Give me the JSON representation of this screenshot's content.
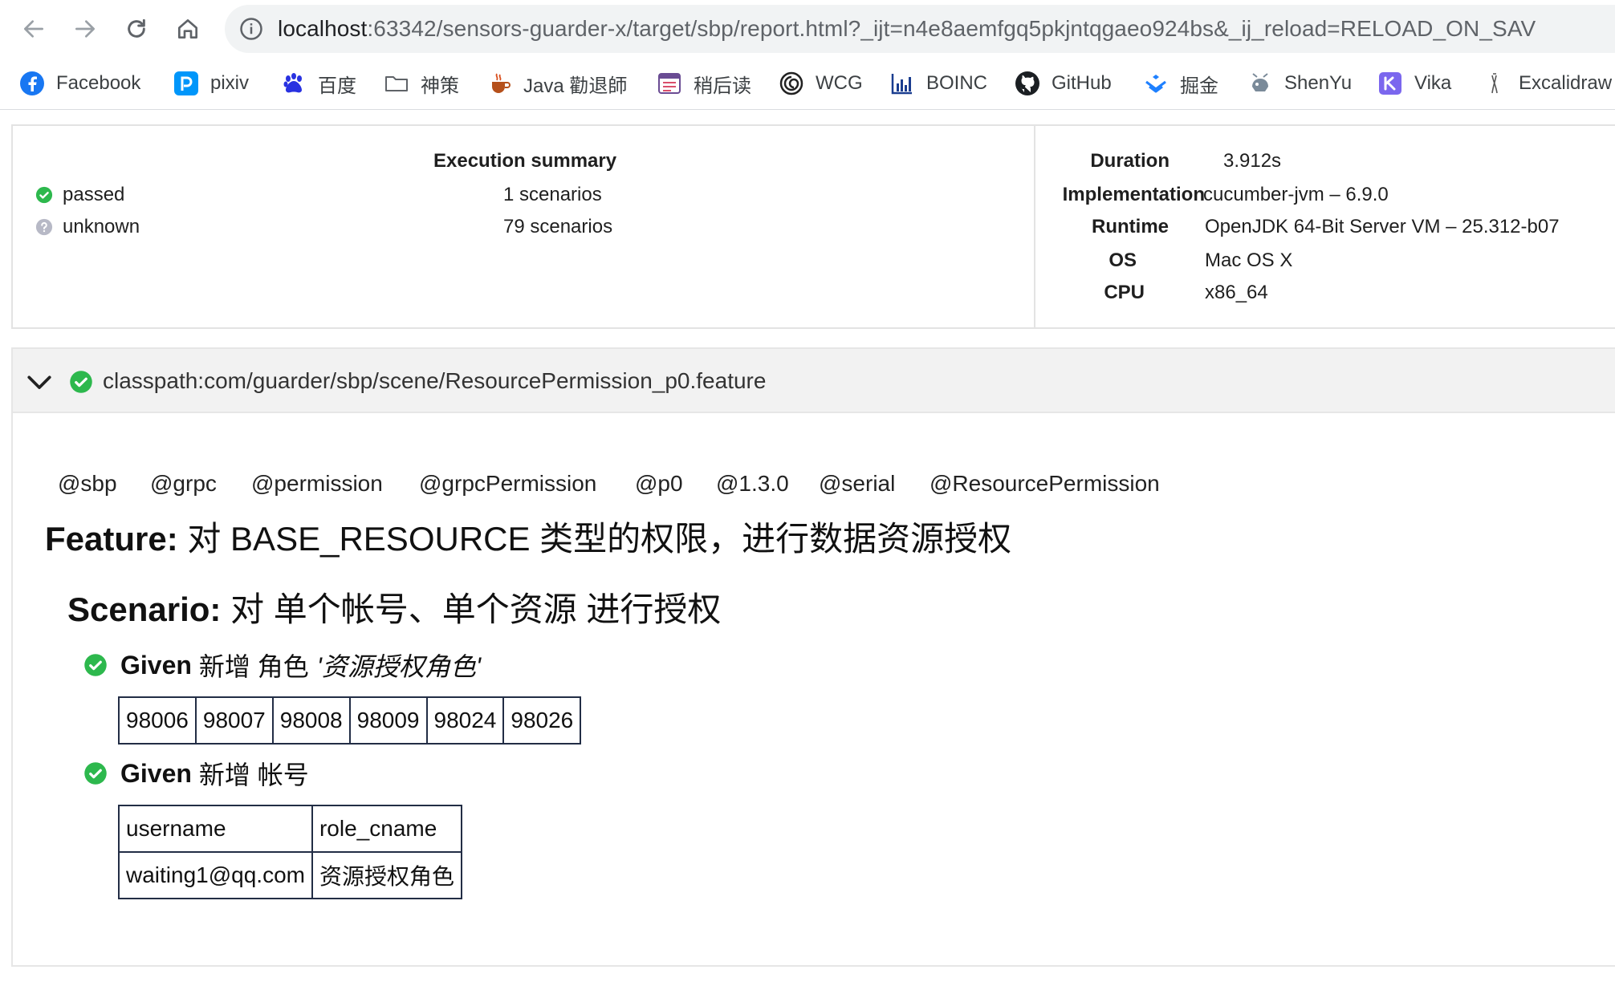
{
  "browser": {
    "url_host": "localhost",
    "url_rest": ":63342/sensors-guarder-x/target/sbp/report.html?_ijt=n4e8aemfgq5pkjntqgaeo924bs&_ij_reload=RELOAD_ON_SAV",
    "bookmarks": [
      {
        "label": "Facebook",
        "icon": "facebook-icon"
      },
      {
        "label": "pixiv",
        "icon": "pixiv-icon"
      },
      {
        "label": "百度",
        "icon": "baidu-icon"
      },
      {
        "label": "神策",
        "icon": "folder-icon"
      },
      {
        "label": "Java 勸退師",
        "icon": "java-icon"
      },
      {
        "label": "稍后读",
        "icon": "read-later-icon"
      },
      {
        "label": "WCG",
        "icon": "wcg-icon"
      },
      {
        "label": "BOINC",
        "icon": "boinc-icon"
      },
      {
        "label": "GitHub",
        "icon": "github-icon"
      },
      {
        "label": "掘金",
        "icon": "juejin-icon"
      },
      {
        "label": "ShenYu",
        "icon": "shenyu-icon"
      },
      {
        "label": "Vika",
        "icon": "vika-icon"
      },
      {
        "label": "Excalidraw",
        "icon": "excalidraw-icon"
      }
    ]
  },
  "summary": {
    "title": "Execution summary",
    "statuses": [
      {
        "label": "passed",
        "count": "1 scenarios",
        "color": "#2db84d"
      },
      {
        "label": "unknown",
        "count": "79 scenarios",
        "color": "#b7b9c6"
      }
    ],
    "meta": [
      {
        "label": "Duration",
        "value": "3.912s"
      },
      {
        "label": "Implementation",
        "value": "cucumber-jvm – 6.9.0"
      },
      {
        "label": "Runtime",
        "value": "OpenJDK 64-Bit Server VM – 25.312-b07"
      },
      {
        "label": "OS",
        "value": "Mac OS X"
      },
      {
        "label": "CPU",
        "value": "x86_64"
      }
    ]
  },
  "feature": {
    "path": "classpath:com/guarder/sbp/scene/ResourcePermission_p0.feature",
    "tags": [
      "@sbp",
      "@grpc",
      "@permission",
      "@grpcPermission",
      "@p0",
      "@1.3.0",
      "@serial",
      "@ResourcePermission"
    ],
    "keyword": "Feature:",
    "name": "对 BASE_RESOURCE 类型的权限，进行数据资源授权",
    "scenario": {
      "keyword": "Scenario:",
      "name": "对 单个帐号、单个资源 进行授权",
      "steps": [
        {
          "keyword": "Given",
          "text": "新增 角色",
          "arg": "'资源授权角色'",
          "table": [
            [
              "98006",
              "98007",
              "98008",
              "98009",
              "98024",
              "98026"
            ]
          ]
        },
        {
          "keyword": "Given",
          "text": "新增 帐号",
          "arg": "",
          "table": [
            [
              "username",
              "role_cname"
            ],
            [
              "waiting1@qq.com",
              "资源授权角色"
            ]
          ]
        }
      ]
    }
  },
  "colors": {
    "passed": "#2db84d",
    "unknown": "#b7b9c6",
    "table_border": "#222d45"
  }
}
